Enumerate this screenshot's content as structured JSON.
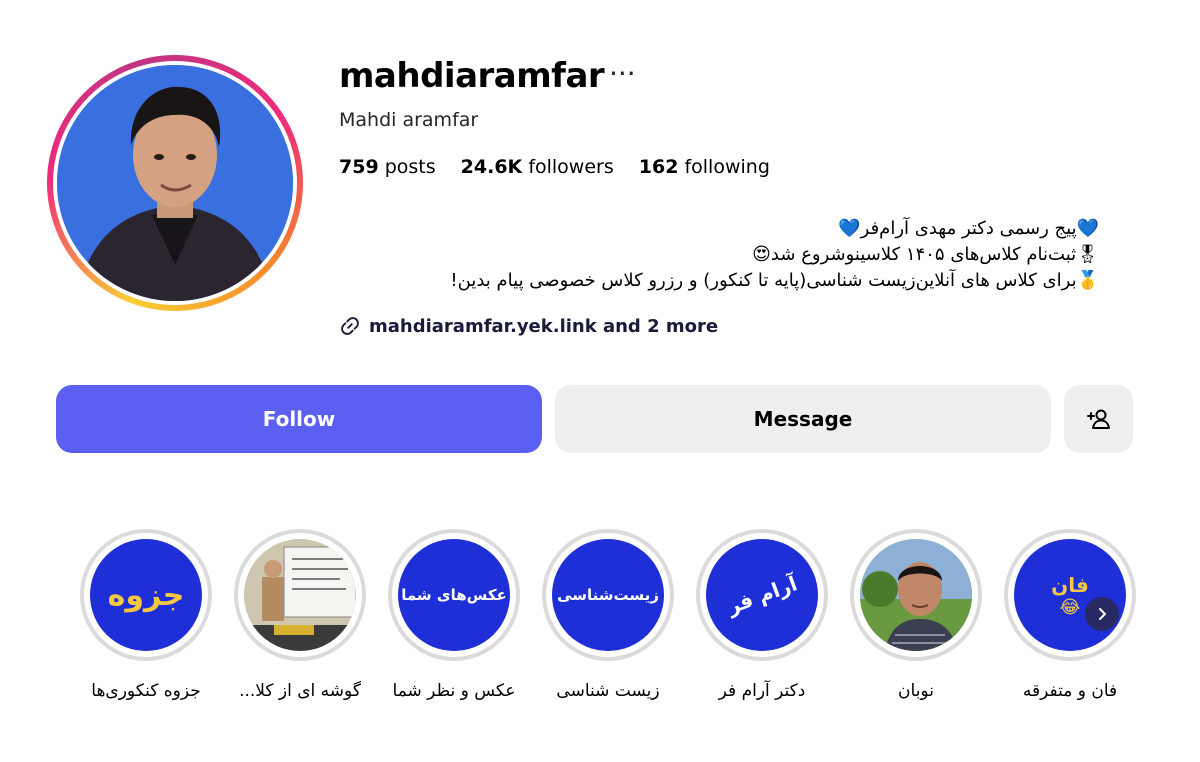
{
  "profile": {
    "username": "mahdiaramfar",
    "more_icon": "ellipsis-icon",
    "full_name": "Mahdi aramfar",
    "stats": {
      "posts_count": "759",
      "posts_label": "posts",
      "followers_count": "24.6K",
      "followers_label": "followers",
      "following_count": "162",
      "following_label": "following"
    },
    "bio": {
      "line1": "💙پیج رسمی دکتر مهدی آرام‌فر💙",
      "line2": "🎖ثبت‌نام کلاس‌های ۱۴۰۵ کلاسینوشروع شد😍",
      "line3": "🥇برای کلاس های آنلاین‌زیست شناسی(پایه تا کنکور) و رزرو کلاس خصوصی پیام بدین!"
    },
    "link_text": "mahdiaramfar.yek.link and 2 more",
    "link_icon": "link-icon"
  },
  "actions": {
    "follow_label": "Follow",
    "message_label": "Message",
    "add_user_icon": "add-user-icon"
  },
  "highlights": [
    {
      "label": "جزوه کنکوری‌ها",
      "cover_text": "جزوه"
    },
    {
      "label": "گوشه ای از کلا...",
      "cover_text": ""
    },
    {
      "label": "عکس و نظر شما",
      "cover_text": "عکس‌های شما"
    },
    {
      "label": "زیست شناسی",
      "cover_text": "زیست‌شناسی"
    },
    {
      "label": "دکتر آرام فر",
      "cover_text": "آرام فر"
    },
    {
      "label": "نوبان",
      "cover_text": ""
    },
    {
      "label": "فان و متفرقه",
      "cover_text": "فان"
    }
  ],
  "colors": {
    "follow_button": "#5b5ff2",
    "secondary_button": "#efefef",
    "highlight_cover": "#1f2fd8"
  }
}
